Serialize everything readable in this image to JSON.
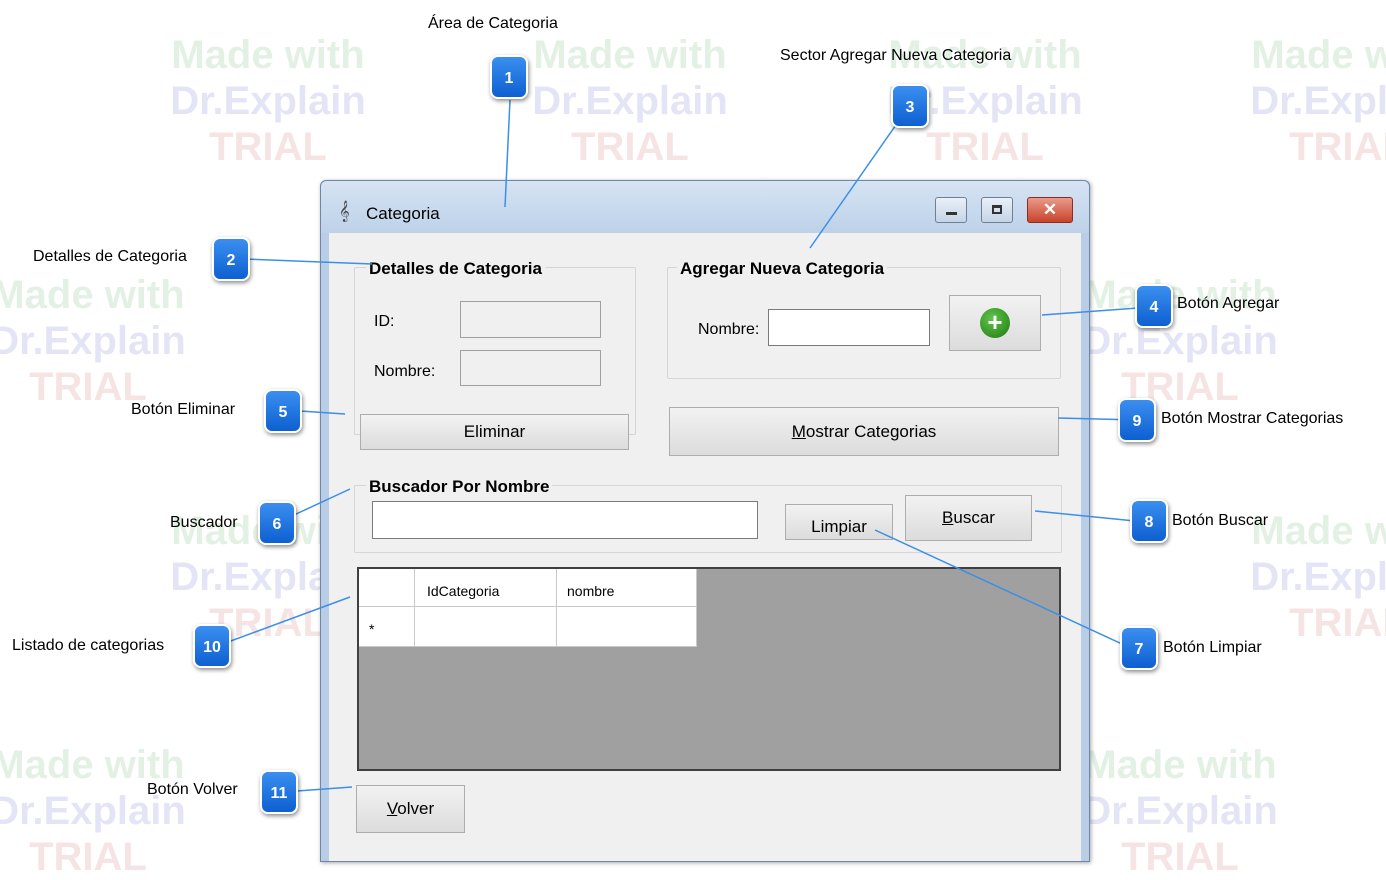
{
  "watermark": {
    "line1": "Made with",
    "line2": "Dr.Explain",
    "line3": "TRIAL"
  },
  "window": {
    "title": "Categoria",
    "app_icon": "music-clef-icon",
    "controls": {
      "minimize": "minimize-icon",
      "maximize": "maximize-icon",
      "close": "close-icon"
    }
  },
  "details_group": {
    "title": "Detalles de Categoria",
    "id_label": "ID:",
    "nombre_label": "Nombre:",
    "id_value": "",
    "nombre_value": ""
  },
  "eliminar_button": {
    "label": "Eliminar"
  },
  "add_group": {
    "title": "Agregar Nueva Categoria",
    "nombre_label": "Nombre:",
    "nombre_value": "",
    "add_icon": "plus-icon"
  },
  "mostrar_button": {
    "label": "Mostrar Categorias",
    "mnemonic": "M",
    "rest": "ostrar Categorias"
  },
  "search_group": {
    "title": "Buscador Por Nombre",
    "query": ""
  },
  "limpiar_button": {
    "label": "Limpiar"
  },
  "buscar_button": {
    "label": "Buscar",
    "mnemonic": "B",
    "rest": "uscar"
  },
  "grid": {
    "columns": [
      "IdCategoria",
      "nombre"
    ],
    "new_row_marker": "*"
  },
  "volver_button": {
    "label": "Volver",
    "mnemonic": "V",
    "rest": "olver"
  },
  "callouts": [
    {
      "num": "1",
      "label": "Área de Categoria"
    },
    {
      "num": "2",
      "label": "Detalles de Categoria"
    },
    {
      "num": "3",
      "label": "Sector Agregar Nueva Categoria"
    },
    {
      "num": "4",
      "label": "Botón Agregar"
    },
    {
      "num": "5",
      "label": "Botón Eliminar"
    },
    {
      "num": "6",
      "label": "Buscador"
    },
    {
      "num": "7",
      "label": "Botón Limpiar"
    },
    {
      "num": "8",
      "label": "Botón Buscar"
    },
    {
      "num": "9",
      "label": "Botón Mostrar Categorias"
    },
    {
      "num": "10",
      "label": "Listado de categorias"
    },
    {
      "num": "11",
      "label": "Botón Volver"
    }
  ],
  "colors": {
    "badge": "#1a6fe0",
    "leader_line": "#3b8fe8",
    "window_frame": "#b9cee6",
    "client_bg": "#f0f0f0",
    "grid_bg": "#a0a0a0",
    "add_icon": "#2e8b1e"
  }
}
